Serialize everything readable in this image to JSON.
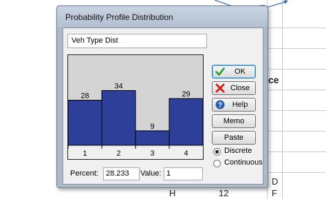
{
  "background": {
    "cells": {
      "top_letter": "E",
      "partial_text": "ce",
      "letter_d": "D",
      "letter_f": "F",
      "col_h": "H",
      "val_12": "12"
    }
  },
  "dialog": {
    "title": "Probability Profile Distribution",
    "name_value": "Veh Type Dist",
    "percent_label": "Percent:",
    "percent_value": "28.233",
    "value_label": "Value:",
    "value_value": "1",
    "buttons": {
      "ok": "OK",
      "close": "Close",
      "help": "Help",
      "memo": "Memo",
      "paste": "Paste"
    },
    "mode": {
      "discrete": "Discrete",
      "continuous": "Continuous",
      "selected": "Discrete"
    },
    "colors": {
      "bar": "#2e3f9a",
      "chart_bg": "#d4d4d4"
    }
  },
  "chart_data": {
    "type": "bar",
    "categories": [
      "1",
      "2",
      "3",
      "4"
    ],
    "values": [
      28,
      34,
      9,
      29
    ],
    "title": "",
    "xlabel": "",
    "ylabel": "",
    "ylim": [
      0,
      56
    ]
  }
}
